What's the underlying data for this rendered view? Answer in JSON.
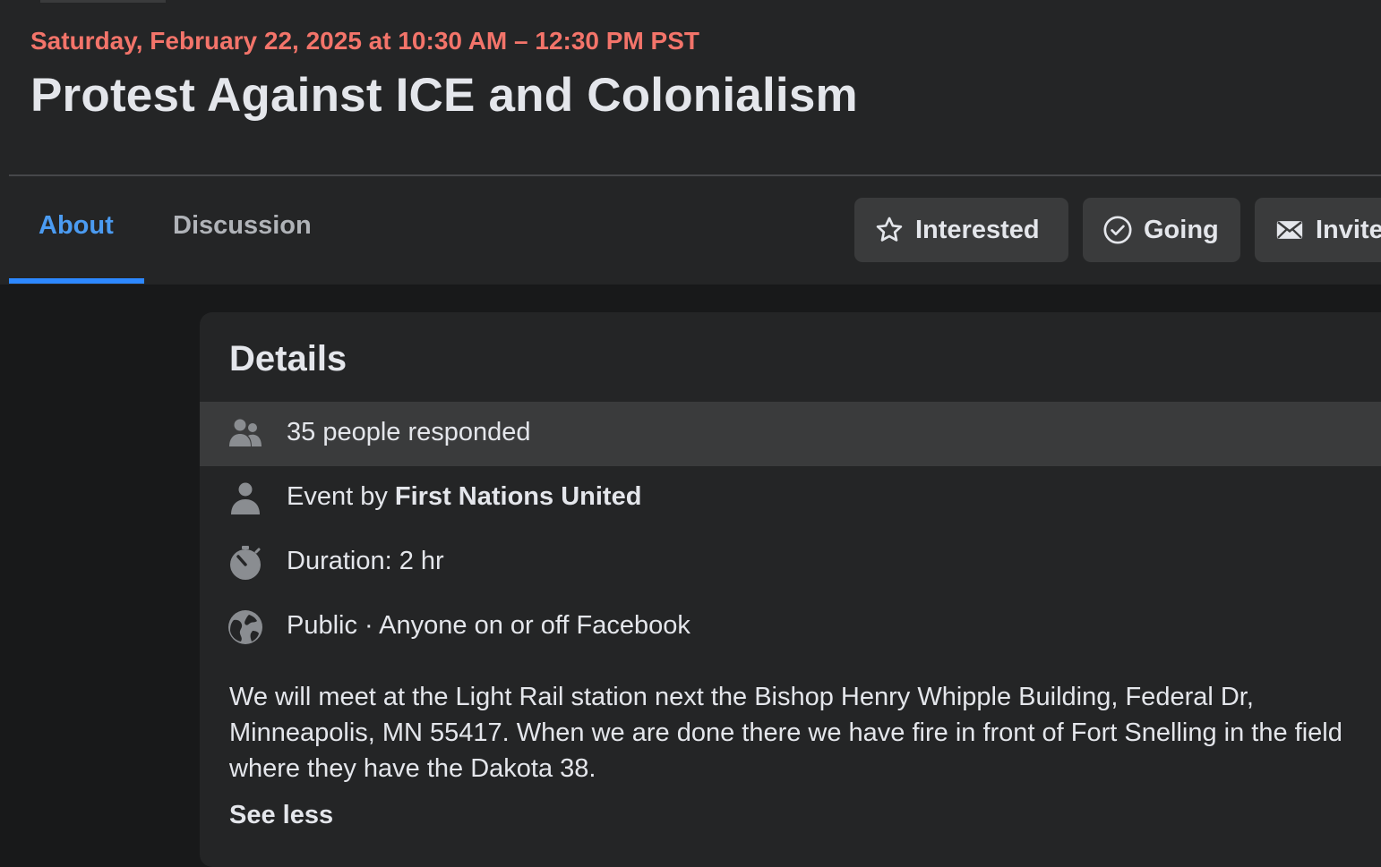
{
  "event": {
    "date_line": "Saturday, February 22, 2025 at 10:30 AM – 12:30 PM PST",
    "title": "Protest Against ICE and Colonialism"
  },
  "tabs": [
    {
      "label": "About",
      "active": true
    },
    {
      "label": "Discussion",
      "active": false
    }
  ],
  "actions": {
    "interested": {
      "label": "Interested",
      "icon": "star-icon"
    },
    "going": {
      "label": "Going",
      "icon": "check-circle-icon"
    },
    "invite": {
      "label": "Invite",
      "icon": "envelope-icon"
    }
  },
  "details": {
    "heading": "Details",
    "responded": {
      "text": "35 people responded",
      "icon": "people-icon"
    },
    "host": {
      "prefix": "Event by ",
      "name": "First Nations United",
      "icon": "person-icon"
    },
    "duration": {
      "text": "Duration: 2 hr",
      "icon": "stopwatch-icon"
    },
    "privacy": {
      "text": "Public · Anyone on or off Facebook",
      "icon": "globe-icon"
    },
    "description": "We will meet at the Light Rail station next the Bishop Henry Whipple Building, Federal Dr, Minneapolis, MN 55417. When we are done there we have fire in front of Fort Snelling in the field where they have the Dakota 38.",
    "see_less": "See less"
  },
  "colors": {
    "date": "#f3746a",
    "active_tab": "#4b9bf1",
    "underline": "#2d88ff",
    "background": "#18191a",
    "card": "#242526",
    "button": "#3a3b3c"
  }
}
